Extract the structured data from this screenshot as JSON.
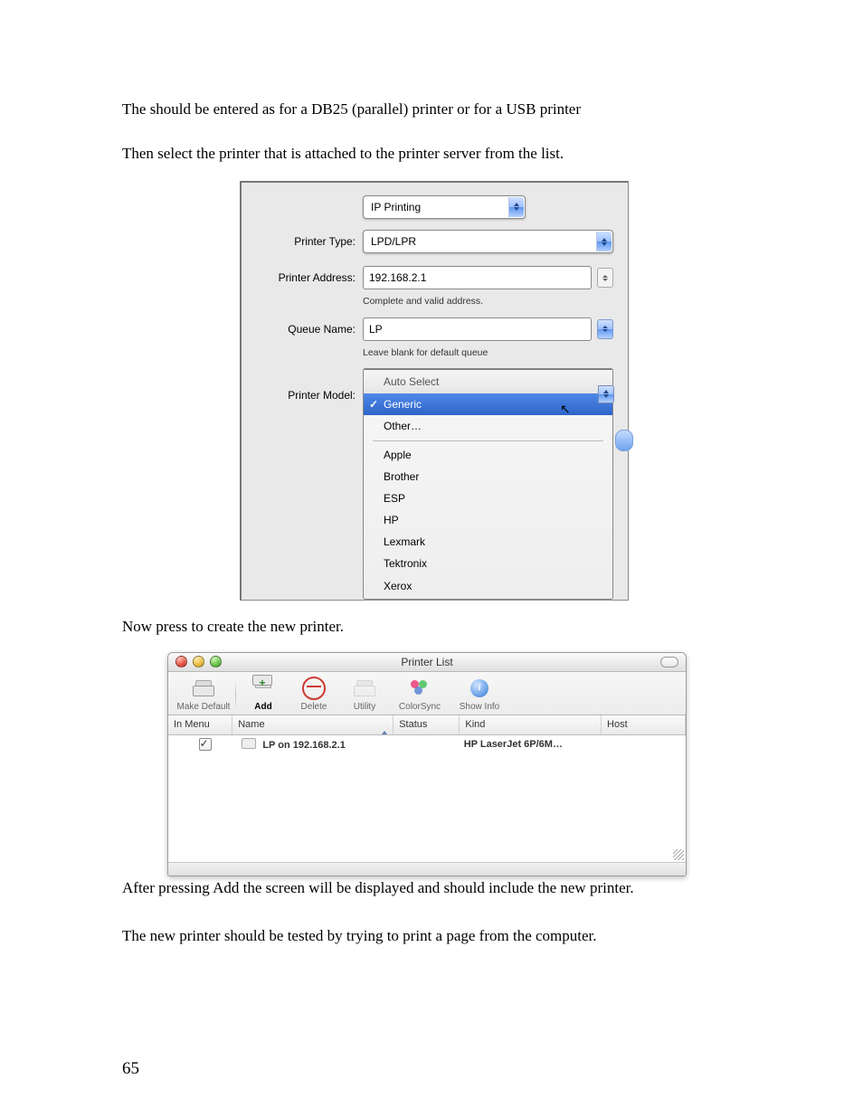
{
  "text": {
    "line1_a": "The ",
    "line1_b": " should be entered as ",
    "line1_c": " for a DB25 (parallel) printer or ",
    "line1_d": " for a USB printer",
    "line2": "Then select the printer that is attached to the printer server from the list.",
    "line3_a": "Now press ",
    "line3_b": " to create the new printer.",
    "line4_a": "After pressing Add the ",
    "line4_b": " screen will be displayed and should include the new printer.",
    "line5": "The new printer should be tested by trying to print a page from the computer.",
    "page_number": "65"
  },
  "dialog": {
    "top_combo": "IP Printing",
    "labels": {
      "printer_type": "Printer Type:",
      "printer_address": "Printer Address:",
      "queue_name": "Queue Name:",
      "printer_model": "Printer Model:"
    },
    "values": {
      "printer_type": "LPD/LPR",
      "printer_address": "192.168.2.1",
      "queue_name": "LP"
    },
    "hints": {
      "address": "Complete and valid address.",
      "queue": "Leave blank for default queue"
    },
    "model_menu": {
      "header": "Auto Select",
      "selected": "Generic",
      "other": "Other…",
      "vendors": [
        "Apple",
        "Brother",
        "ESP",
        "HP",
        "Lexmark",
        "Tektronix",
        "Xerox"
      ]
    }
  },
  "printer_list": {
    "title": "Printer List",
    "toolbar": {
      "make_default": "Make Default",
      "add": "Add",
      "delete": "Delete",
      "utility": "Utility",
      "colorsync": "ColorSync",
      "show_info": "Show Info"
    },
    "columns": {
      "in_menu": "In Menu",
      "name": "Name",
      "status": "Status",
      "kind": "Kind",
      "host": "Host"
    },
    "rows": [
      {
        "in_menu": true,
        "name": "LP    on 192.168.2.1",
        "status": "",
        "kind": "HP LaserJet 6P/6M…",
        "host": ""
      }
    ]
  }
}
